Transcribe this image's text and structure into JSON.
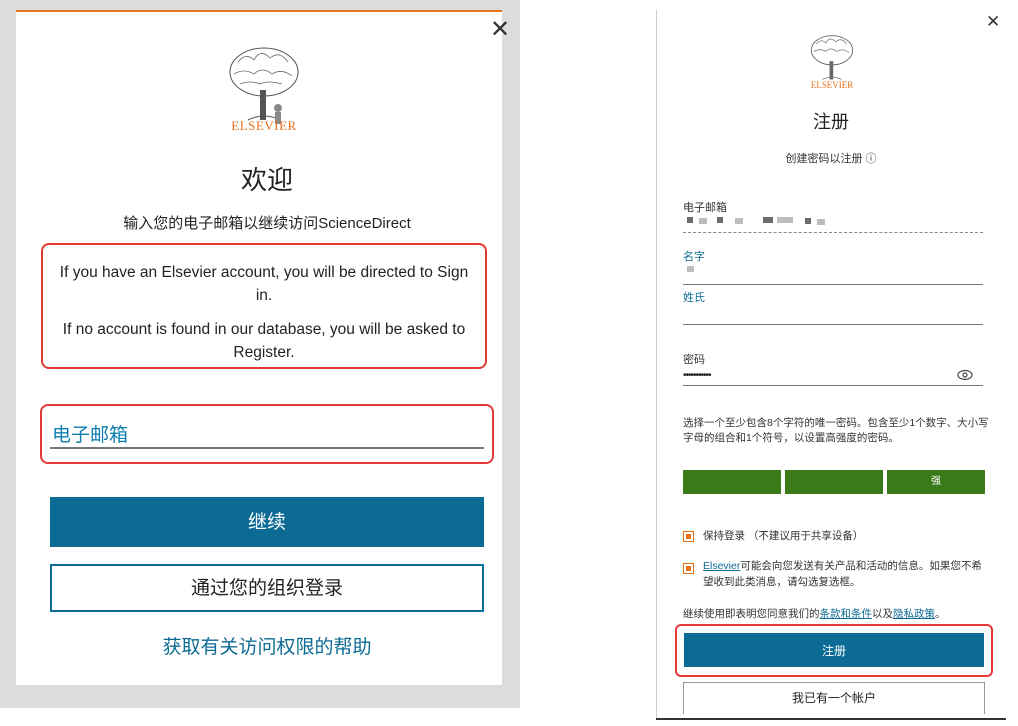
{
  "left": {
    "brand": "ELSEVIER",
    "title": "欢迎",
    "subtitle": "输入您的电子邮箱以继续访问ScienceDirect",
    "info_line1": "If you have an Elsevier account, you will be directed to Sign in.",
    "info_line2": "If no account is found in our database, you will be asked to Register.",
    "email_label": "电子邮箱",
    "continue_button": "继续",
    "org_login_button": "通过您的组织登录",
    "help_link": "获取有关访问权限的帮助",
    "close_glyph": "✕"
  },
  "right": {
    "brand": "ELSEVIER",
    "title": "注册",
    "subtitle": "创建密码以注册 ⓘ",
    "email_label": "电子邮箱",
    "first_name_label": "名字",
    "last_name_label": "姓氏",
    "password_label": "密码",
    "password_value": "•••••••••••",
    "password_hint": "选择一个至少包含8个字符的唯一密码。包含至少1个数字、大小写字母的组合和1个符号，以设置高强度的密码。",
    "strength_label": "强",
    "stay_signed_in": "保持登录 （不建议用于共享设备）",
    "marketing_link": "Elsevier",
    "marketing_text": "可能会向您发送有关产品和活动的信息。如果您不希望收到此类消息，请勾选复选框。",
    "terms_prefix": "继续使用即表明您同意我们的",
    "terms_link": "条款和条件",
    "terms_middle": "以及",
    "privacy_link": "隐私政策",
    "terms_suffix": "。",
    "register_button": "注册",
    "have_account_button": "我已有一个帐户",
    "close_glyph": "✕"
  },
  "colors": {
    "brand_orange": "#e9711c",
    "primary_blue": "#0c6b94",
    "highlight_red": "#e53935",
    "strength_green": "#3a7a19"
  }
}
